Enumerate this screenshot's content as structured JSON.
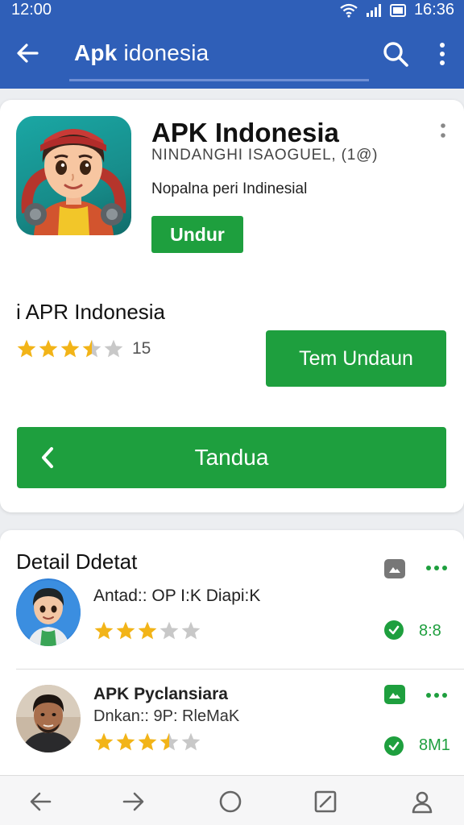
{
  "status_bar": {
    "time_left": "12:00",
    "time_right": "16:36"
  },
  "app_bar": {
    "title_strong": "Apk",
    "title_rest": " idonesia"
  },
  "app": {
    "name": "APK Indonesia",
    "subtitle": "NINDANGHI ISAOGUEL, (1@)",
    "description": "Nopalna peri Indinesial",
    "install_label": "Undur"
  },
  "app_section": {
    "heading": "i APR Indonesia",
    "rating": 3.5,
    "rating_count": "15",
    "secondary_button": "Tem Undaun",
    "wide_button": "Tandua"
  },
  "details": {
    "title": "Detail Ddetat",
    "rows": [
      {
        "title": "Antad:: OP I:K Diapi:K",
        "subtitle": "",
        "rating": 3,
        "score": "8:8"
      },
      {
        "title": "APK Pyclansiara",
        "subtitle": "Dnkan:: 9P: RleMaK",
        "rating": 3.5,
        "score": "8M1"
      }
    ]
  },
  "colors": {
    "primary_blue": "#2f5fb8",
    "accent_green": "#1e9f3e",
    "star": "#f2b418"
  }
}
